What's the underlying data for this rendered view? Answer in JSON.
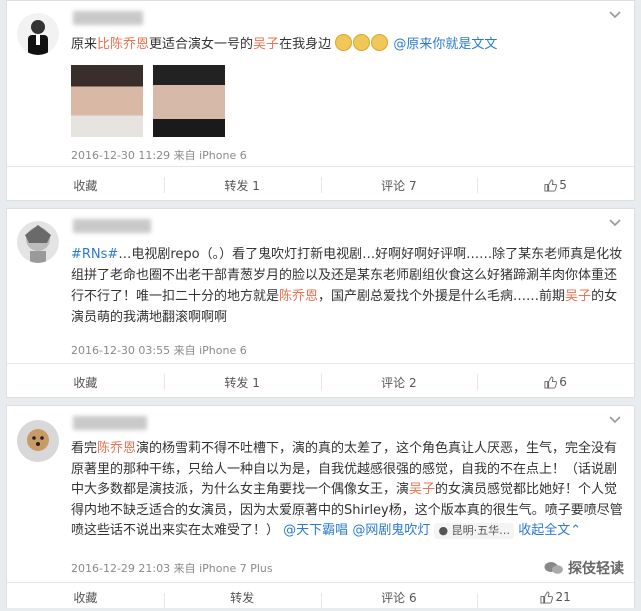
{
  "posts": [
    {
      "text_pre": "原来",
      "text_hl1": "比陈乔恩",
      "text_mid": "更适合演女一号的",
      "text_hl2": "吴子",
      "text_post": "在我身边",
      "mention": "@原来你就是文文",
      "timestamp": "2016-12-30 11:29 来自 iPhone 6",
      "actions": {
        "collect": "收藏",
        "repost": "转发 1",
        "comment": "评论 7",
        "like": "5"
      }
    },
    {
      "tag": "#RNs#",
      "p1": "…电视剧repo（。）看了鬼吹灯打新电视剧…好啊好啊好评啊……除了某东老师真是化妆组拼了老命也圈不出老干部青葱岁月的脸以及还是某东老师剧组伙食这么好猪蹄涮羊肉你体重还行不行了！唯一扣二十分的地方就是",
      "hl1": "陈乔恩",
      "p2": "，国产剧总爱找个外援是什么毛病……前期",
      "hl2": "吴子",
      "p3": "的女演员萌的我满地翻滚啊啊啊",
      "timestamp": "2016-12-30 03:55 来自 iPhone 6",
      "actions": {
        "collect": "收藏",
        "repost": "转发 1",
        "comment": "评论 2",
        "like": "6"
      }
    },
    {
      "p0": "看完",
      "hl1": "陈乔恩",
      "p1": "演的杨雪莉不得不吐槽下，演的真的太差了，这个角色真让人厌恶，生气，完全没有原著里的那种干练，只给人一种自以为是，自我优越感很强的感觉，自我的不在点上！（话说剧中大多数都是演技派，为什么女主角要找一个偶像女王，演",
      "hl2": "吴子",
      "p2": "的女演员感觉都比她好！个人觉得内地不缺乏适合的女演员，因为太爱原著中的Shirley杨，这个版本真的很生气。喷子要喷尽管喷这些话不说出来实在太难受了！）",
      "mention1": "@天下霸唱",
      "mention2": "@网剧鬼吹灯",
      "location": "昆明·五华…",
      "collapse": "收起全文",
      "timestamp": "2016-12-29 21:03 来自 iPhone 7 Plus",
      "actions": {
        "collect": "收藏",
        "repost": "转发",
        "comment": "评论 6",
        "like": "21"
      }
    }
  ],
  "watermark": "探伎轻读",
  "colors": {
    "highlight": "#eb7350",
    "link": "#2a7ad2",
    "meta": "#8a8a8a"
  }
}
